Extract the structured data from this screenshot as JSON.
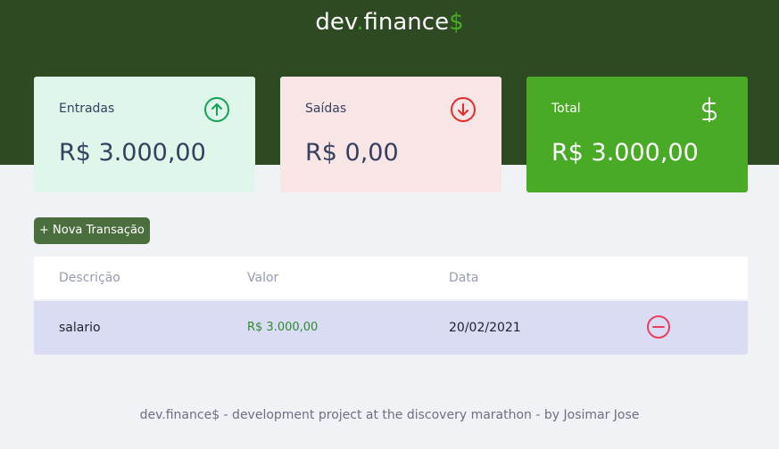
{
  "header": {
    "logo_main": "dev",
    "logo_dot": ".",
    "logo_word": "finance",
    "logo_dollar": "$"
  },
  "cards": {
    "income": {
      "label": "Entradas",
      "value": "R$ 3.000,00",
      "icon": "arrow-up-circle-icon"
    },
    "expense": {
      "label": "Saídas",
      "value": "R$ 0,00",
      "icon": "arrow-down-circle-icon"
    },
    "total": {
      "label": "Total",
      "value": "R$ 3.000,00",
      "icon": "dollar-sign-icon"
    }
  },
  "actions": {
    "new_transaction": "+ Nova Transação"
  },
  "table": {
    "headers": {
      "description": "Descrição",
      "value": "Valor",
      "date": "Data"
    },
    "rows": [
      {
        "description": "salario",
        "value": "R$ 3.000,00",
        "date": "20/02/2021",
        "action_icon": "remove-circle-icon"
      }
    ]
  },
  "footer": {
    "text": "dev.finance$ - development project at the discovery marathon - by Josimar Jose"
  },
  "colors": {
    "header_bg": "#2d4a22",
    "accent_green": "#49aa26",
    "income_card": "#dff6ea",
    "expense_card": "#f8e6e6",
    "button_bg": "#4b6e3f",
    "row_bg": "#dadcf3",
    "income_icon": "#12a454",
    "expense_icon": "#e92929"
  }
}
